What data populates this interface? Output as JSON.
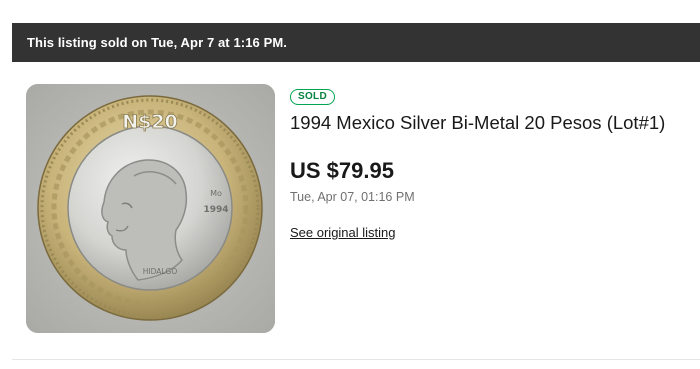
{
  "banner": {
    "text": "This listing sold on Tue, Apr 7 at 1:16 PM."
  },
  "listing": {
    "status_badge": "SOLD",
    "title": "1994 Mexico Silver Bi-Metal 20 Pesos (Lot#1)",
    "price": "US $79.95",
    "sold_date": "Tue, Apr 07, 01:16 PM",
    "original_link_label": "See original listing"
  },
  "coin_image": {
    "denomination": "N$20",
    "year": "1994",
    "mint_mark": "Mo",
    "portrait_name": "HIDALGO"
  },
  "colors": {
    "banner_bg": "#333333",
    "badge_green": "#05823f",
    "muted_text": "#707070"
  }
}
